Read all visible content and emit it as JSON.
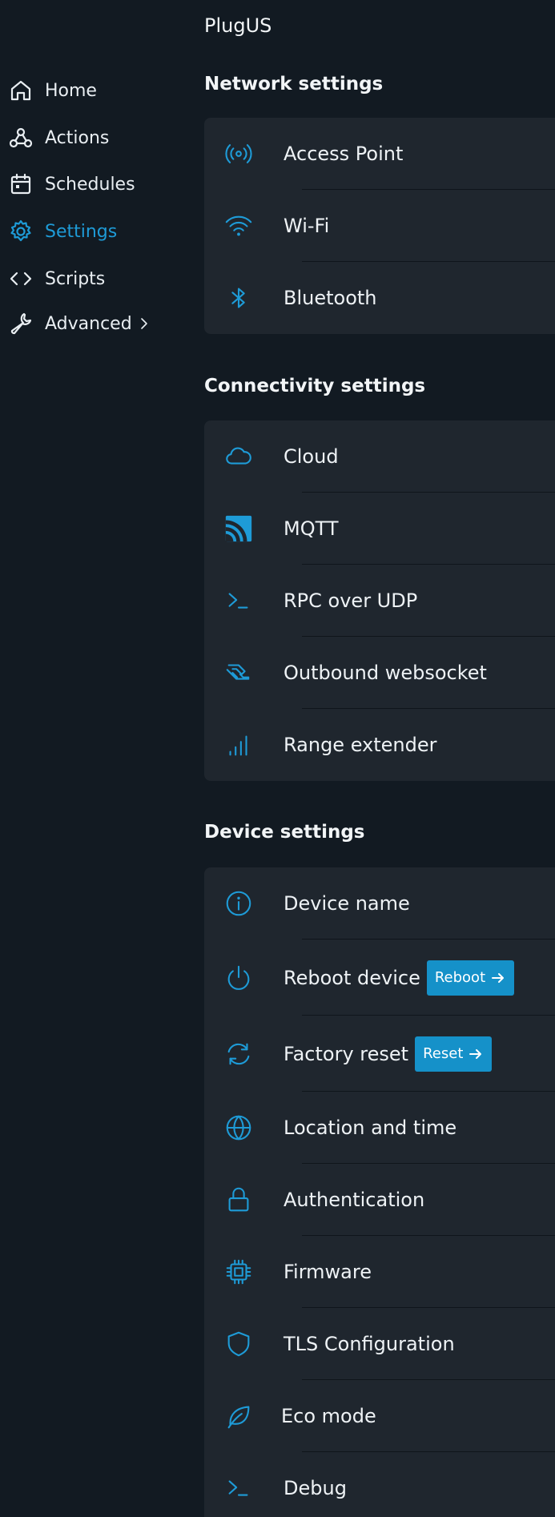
{
  "app": {
    "title": "PlugUS"
  },
  "colors": {
    "accent": "#1e9bd7",
    "background": "#121a22",
    "card": "#1f262e",
    "button": "#1591c9"
  },
  "sidebar": {
    "items": [
      {
        "label": "Home",
        "icon": "home-icon"
      },
      {
        "label": "Actions",
        "icon": "webhook-icon"
      },
      {
        "label": "Schedules",
        "icon": "calendar-icon"
      },
      {
        "label": "Settings",
        "icon": "gear-icon",
        "active": true
      },
      {
        "label": "Scripts",
        "icon": "code-icon"
      },
      {
        "label": "Advanced",
        "icon": "wrench-icon",
        "has_submenu": true
      }
    ]
  },
  "sections": {
    "network": {
      "title": "Network settings",
      "items": [
        {
          "label": "Access Point",
          "icon": "access-point-icon"
        },
        {
          "label": "Wi-Fi",
          "icon": "wifi-icon"
        },
        {
          "label": "Bluetooth",
          "icon": "bluetooth-icon"
        }
      ]
    },
    "connectivity": {
      "title": "Connectivity settings",
      "items": [
        {
          "label": "Cloud",
          "icon": "cloud-icon"
        },
        {
          "label": "MQTT",
          "icon": "rss-icon"
        },
        {
          "label": "RPC over UDP",
          "icon": "terminal-icon"
        },
        {
          "label": "Outbound websocket",
          "icon": "websocket-icon"
        },
        {
          "label": "Range extender",
          "icon": "signal-bars-icon"
        }
      ]
    },
    "device": {
      "title": "Device settings",
      "items": [
        {
          "label": "Device name",
          "icon": "info-icon"
        },
        {
          "label": "Reboot device",
          "icon": "power-icon",
          "button": "Reboot"
        },
        {
          "label": "Factory reset",
          "icon": "refresh-icon",
          "button": "Reset"
        },
        {
          "label": "Location and time",
          "icon": "globe-icon"
        },
        {
          "label": "Authentication",
          "icon": "lock-icon"
        },
        {
          "label": "Firmware",
          "icon": "chip-icon"
        },
        {
          "label": "TLS Configuration",
          "icon": "shield-icon"
        },
        {
          "label": "Eco mode",
          "icon": "leaf-icon"
        },
        {
          "label": "Debug",
          "icon": "terminal-icon"
        }
      ]
    }
  }
}
